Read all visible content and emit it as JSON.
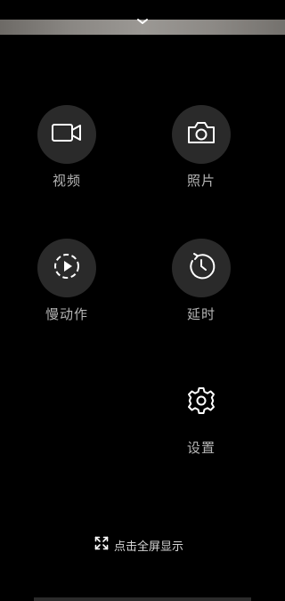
{
  "modes": {
    "video": {
      "label": "视频",
      "icon": "video-camera-icon"
    },
    "photo": {
      "label": "照片",
      "icon": "camera-icon"
    },
    "slowmo": {
      "label": "慢动作",
      "icon": "slow-motion-icon"
    },
    "timelapse": {
      "label": "延时",
      "icon": "timelapse-icon"
    }
  },
  "settings": {
    "label": "设置",
    "icon": "gear-icon"
  },
  "fullscreen": {
    "label": "点击全屏显示",
    "icon": "expand-icon"
  },
  "colors": {
    "background": "#000000",
    "button_bg": "#2a2a2a",
    "label": "#b5b5b5",
    "icon": "#ffffff"
  }
}
